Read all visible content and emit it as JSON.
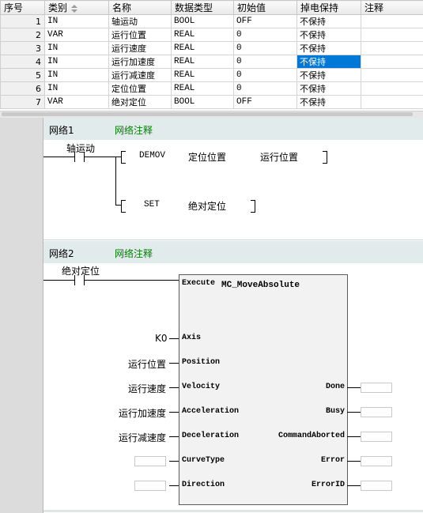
{
  "table": {
    "headers": [
      "序号",
      "类别",
      "名称",
      "数据类型",
      "初始值",
      "掉电保持",
      "注释"
    ],
    "sort_icon": "sort-arrows-icon",
    "rows": [
      {
        "index": "1",
        "kind": "IN",
        "name": "轴运动",
        "type": "BOOL",
        "init": "OFF",
        "retain": "不保持",
        "comment": ""
      },
      {
        "index": "2",
        "kind": "VAR",
        "name": "运行位置",
        "type": "REAL",
        "init": "0",
        "retain": "不保持",
        "comment": ""
      },
      {
        "index": "3",
        "kind": "IN",
        "name": "运行速度",
        "type": "REAL",
        "init": "0",
        "retain": "不保持",
        "comment": ""
      },
      {
        "index": "4",
        "kind": "IN",
        "name": "运行加速度",
        "type": "REAL",
        "init": "0",
        "retain": "不保持",
        "comment": ""
      },
      {
        "index": "5",
        "kind": "IN",
        "name": "运行减速度",
        "type": "REAL",
        "init": "0",
        "retain": "不保持",
        "comment": ""
      },
      {
        "index": "6",
        "kind": "IN",
        "name": "定位位置",
        "type": "REAL",
        "init": "0",
        "retain": "不保持",
        "comment": ""
      },
      {
        "index": "7",
        "kind": "VAR",
        "name": "绝对定位",
        "type": "BOOL",
        "init": "OFF",
        "retain": "不保持",
        "comment": ""
      }
    ],
    "selected_row_index": "4",
    "selected_column": "掉电保持",
    "selection_color": "#0078d7"
  },
  "network1": {
    "label": "网络1",
    "comment": "网络注释",
    "contact": "轴运动",
    "instr1": {
      "op": "DEMOV",
      "arg1": "定位位置",
      "arg2": "运行位置"
    },
    "instr2": {
      "op": "SET",
      "arg1": "绝对定位"
    }
  },
  "network2": {
    "label": "网络2",
    "comment": "网络注释",
    "contact": "绝对定位",
    "fb": {
      "name": "MC_MoveAbsolute",
      "inputs": [
        {
          "pin": "Execute",
          "value": ""
        },
        {
          "pin": "Axis",
          "value": "K0"
        },
        {
          "pin": "Position",
          "value": "运行位置"
        },
        {
          "pin": "Velocity",
          "value": "运行速度"
        },
        {
          "pin": "Acceleration",
          "value": "运行加速度"
        },
        {
          "pin": "Deceleration",
          "value": "运行减速度"
        },
        {
          "pin": "CurveType",
          "value": ""
        },
        {
          "pin": "Direction",
          "value": ""
        }
      ],
      "outputs": [
        "Done",
        "Busy",
        "CommandAborted",
        "Error",
        "ErrorID"
      ]
    }
  },
  "colors": {
    "comment_green": "#008000",
    "header_bg": "#e2ebeb",
    "gutter": "#dcdcdc"
  }
}
